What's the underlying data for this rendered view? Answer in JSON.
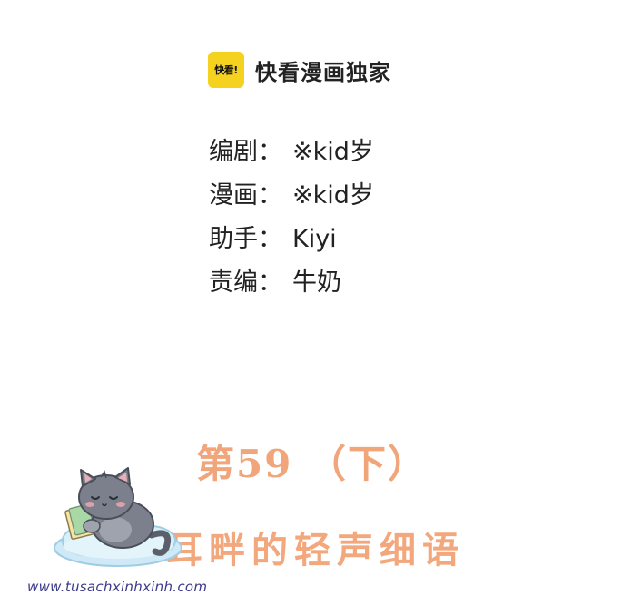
{
  "brand": {
    "logo_text": "快看!",
    "name": "快看漫画独家",
    "logo_color": "#f5d21f"
  },
  "credits": [
    {
      "label": "编剧",
      "colon": "：",
      "value": "※kid岁"
    },
    {
      "label": "漫画",
      "colon": "：",
      "value": "※kid岁"
    },
    {
      "label": "助手",
      "colon": "：",
      "value": "Kiyi"
    },
    {
      "label": "责编",
      "colon": "：",
      "value": "牛奶"
    }
  ],
  "chapter": {
    "text": "第59 （下）",
    "color": "#f0a57a"
  },
  "subtitle": {
    "text": "耳畔的轻声细语",
    "color": "#f2a77d"
  },
  "illustration": {
    "icon": "cat-on-cloud-icon"
  },
  "watermark": {
    "text": "www.tusachxinhxinh.com",
    "color": "#3b3b8a"
  }
}
